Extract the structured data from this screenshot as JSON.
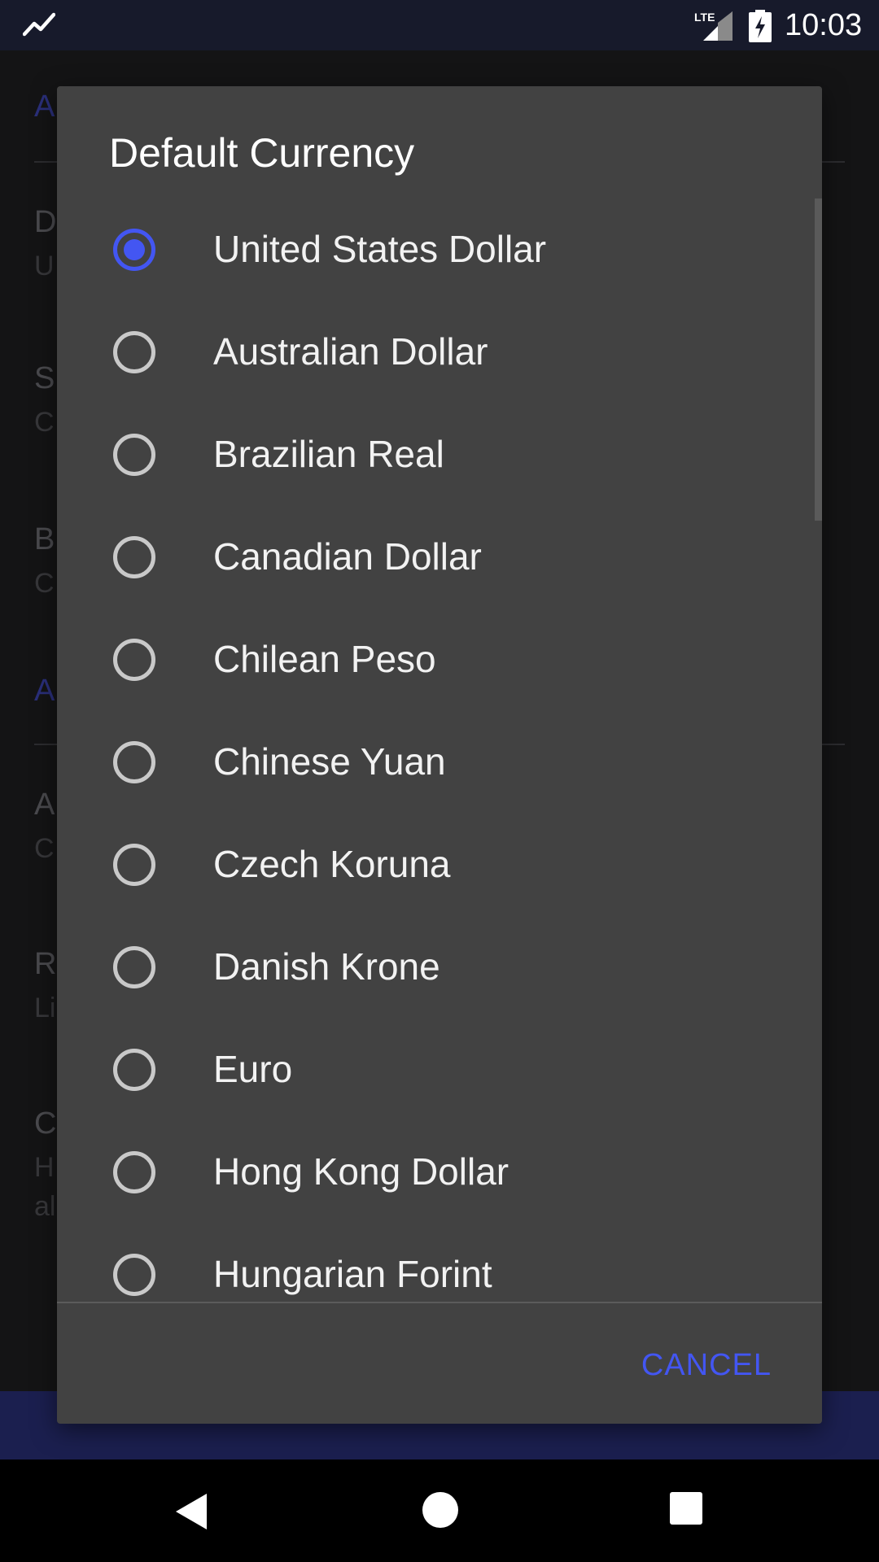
{
  "status_bar": {
    "time": "10:03",
    "network": "LTE",
    "icons": [
      "trending-icon",
      "lte-signal-icon",
      "battery-charging-icon"
    ]
  },
  "dialog": {
    "title": "Default Currency",
    "selected": "United States Dollar",
    "options": [
      {
        "label": "United States Dollar",
        "selected": true
      },
      {
        "label": "Australian Dollar",
        "selected": false
      },
      {
        "label": "Brazilian Real",
        "selected": false
      },
      {
        "label": "Canadian Dollar",
        "selected": false
      },
      {
        "label": "Chilean Peso",
        "selected": false
      },
      {
        "label": "Chinese Yuan",
        "selected": false
      },
      {
        "label": "Czech Koruna",
        "selected": false
      },
      {
        "label": "Danish Krone",
        "selected": false
      },
      {
        "label": "Euro",
        "selected": false
      },
      {
        "label": "Hong Kong Dollar",
        "selected": false
      },
      {
        "label": "Hungarian Forint",
        "selected": false
      }
    ],
    "cancel_label": "CANCEL"
  },
  "colors": {
    "accent": "#4356f2",
    "dialog_bg": "#424242",
    "status_bar": "#171a2b"
  },
  "nav_bar": {
    "icons": [
      "back-icon",
      "home-icon",
      "recents-icon"
    ]
  }
}
